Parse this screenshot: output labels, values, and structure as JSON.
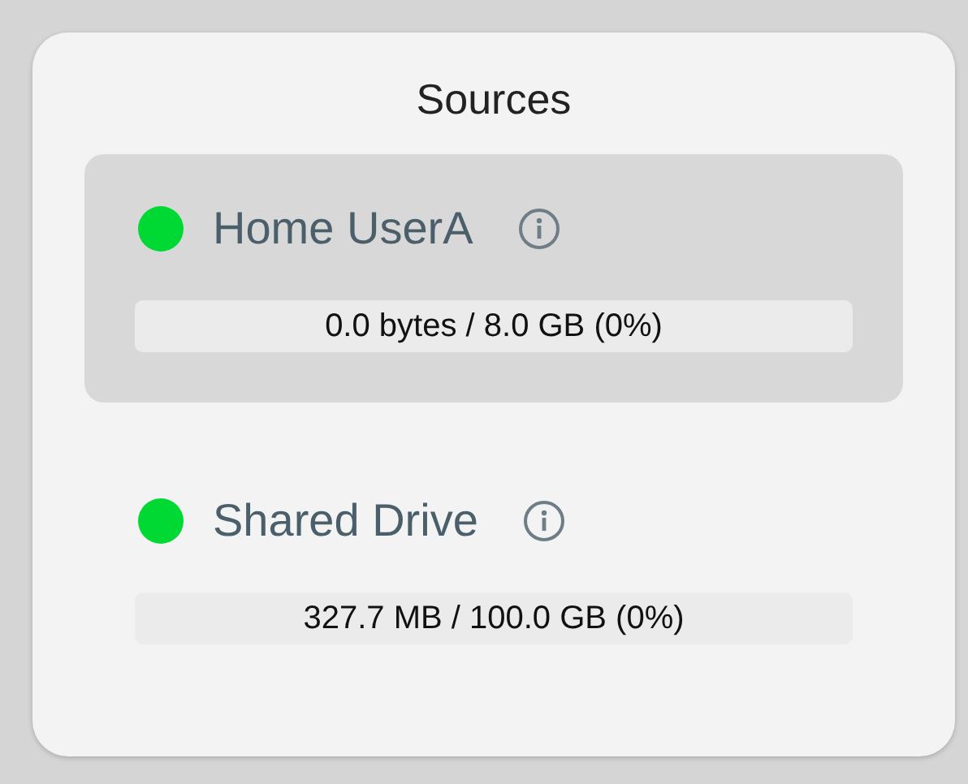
{
  "panel": {
    "title": "Sources"
  },
  "sources": [
    {
      "name": "Home UserA",
      "color": "#00d834",
      "selected": true,
      "level": 0,
      "usage": "0.0 bytes / 8.0 GB (0%)"
    },
    {
      "name": "Shared Drive",
      "color": "#00d834",
      "selected": false,
      "level": 0,
      "usage": "327.7 MB / 100.0 GB (0%)"
    }
  ]
}
